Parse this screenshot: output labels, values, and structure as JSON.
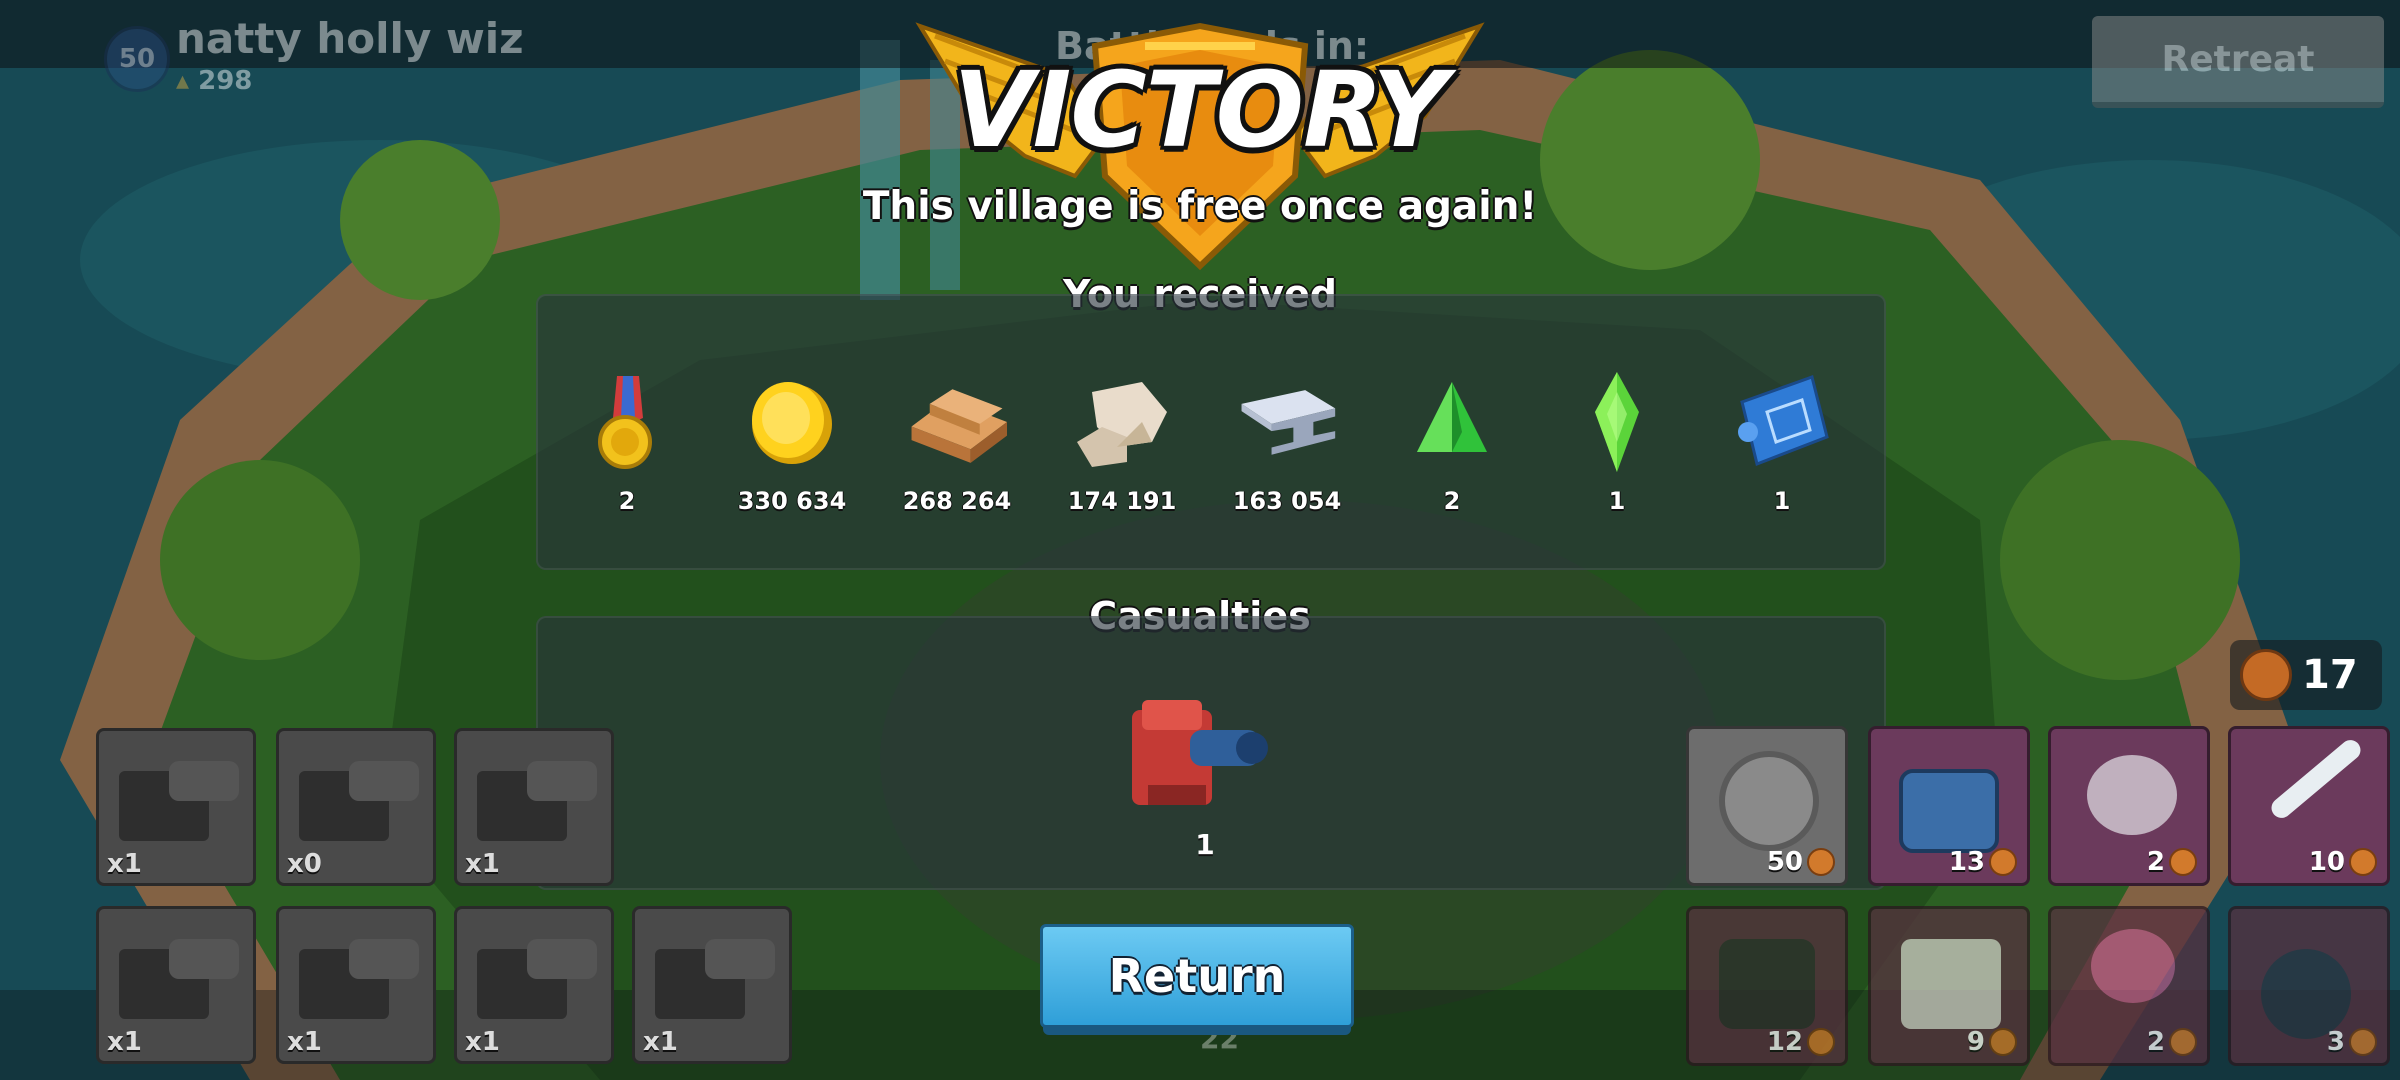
{
  "player": {
    "level": "50",
    "name": "natty holly wiz",
    "trophies": "298"
  },
  "header": {
    "battle_ends_label": "Battle ends in:",
    "retreat_label": "Retreat"
  },
  "result": {
    "title": "VICTORY",
    "subtitle": "This village is free once again!"
  },
  "rewards": {
    "title": "You received",
    "items": [
      {
        "icon": "medal-icon",
        "value": "2"
      },
      {
        "icon": "gold-coin-icon",
        "value": "330 634"
      },
      {
        "icon": "wood-icon",
        "value": "268 264"
      },
      {
        "icon": "stone-icon",
        "value": "174 191"
      },
      {
        "icon": "iron-icon",
        "value": "163 054"
      },
      {
        "icon": "green-crystal-icon",
        "value": "2"
      },
      {
        "icon": "green-gem-icon",
        "value": "1"
      },
      {
        "icon": "blueprint-icon",
        "value": "1"
      }
    ]
  },
  "casualties": {
    "title": "Casualties",
    "items": [
      {
        "icon": "heavy-trooper-icon",
        "value": "1"
      }
    ]
  },
  "troops": [
    {
      "count": "x1"
    },
    {
      "count": "x0"
    },
    {
      "count": "x1"
    },
    {
      "count": "x1"
    },
    {
      "count": "x1"
    },
    {
      "count": "x1"
    },
    {
      "count": "x1"
    }
  ],
  "energy": {
    "value": "17"
  },
  "abilities": [
    {
      "icon": "barrage-icon",
      "cost": "50",
      "color": "#6d6d6d"
    },
    {
      "icon": "robot-warrior-icon",
      "cost": "13",
      "color": "#6b3a5c"
    },
    {
      "icon": "smoke-screen-icon",
      "cost": "2",
      "color": "#6b3a5c"
    },
    {
      "icon": "rocket-icon",
      "cost": "10",
      "color": "#6b3a5c"
    },
    {
      "icon": "shock-bomb-icon",
      "cost": "12",
      "color": "#56303f"
    },
    {
      "icon": "medkit-icon",
      "cost": "9",
      "color": "#56303f"
    },
    {
      "icon": "flare-icon",
      "cost": "2",
      "color": "#56303f"
    },
    {
      "icon": "bomb-icon",
      "cost": "3",
      "color": "#56303f"
    }
  ],
  "hidden_value": "22",
  "return_label": "Return",
  "colors": {
    "return": "#3fb0e5",
    "panel": "#28343c",
    "gold": "#f3c11b"
  }
}
